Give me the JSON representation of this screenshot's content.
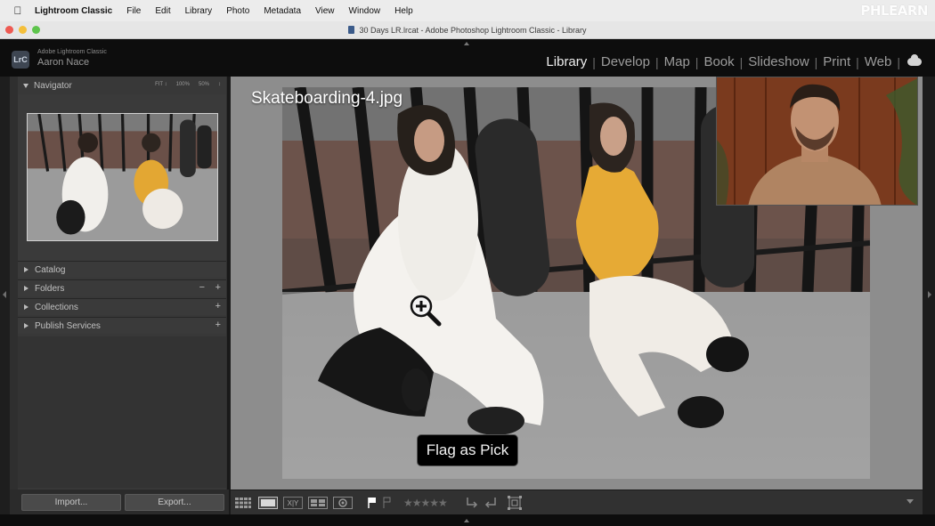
{
  "menubar": {
    "app": "Lightroom Classic",
    "items": [
      "File",
      "Edit",
      "Library",
      "Photo",
      "Metadata",
      "View",
      "Window",
      "Help"
    ],
    "watermark": "PHLEARN"
  },
  "window": {
    "title": "30 Days LR.lrcat - Adobe Photoshop Lightroom Classic - Library"
  },
  "identity": {
    "badge": "LrC",
    "product": "Adobe Lightroom Classic",
    "user": "Aaron Nace"
  },
  "modules": {
    "items": [
      {
        "label": "Library",
        "active": true
      },
      {
        "label": "Develop"
      },
      {
        "label": "Map"
      },
      {
        "label": "Book"
      },
      {
        "label": "Slideshow"
      },
      {
        "label": "Print"
      },
      {
        "label": "Web"
      }
    ],
    "cloud_icon": "cloud-icon"
  },
  "left_panel": {
    "navigator": {
      "title": "Navigator",
      "zoom_options": [
        "FIT ↕",
        "100%",
        "50%",
        "↕"
      ]
    },
    "sections": [
      {
        "label": "Catalog",
        "controls": ""
      },
      {
        "label": "Folders",
        "controls": "+",
        "extra": "−"
      },
      {
        "label": "Collections",
        "controls": "+"
      },
      {
        "label": "Publish Services",
        "controls": "+"
      }
    ],
    "import_label": "Import...",
    "export_label": "Export..."
  },
  "center": {
    "filename": "Skateboarding-4.jpg",
    "toast": "Flag as Pick",
    "cursor_icon": "zoom-in-cursor-icon"
  },
  "toolbar": {
    "views": [
      "grid-view-icon",
      "loupe-view-icon",
      "compare-view-icon",
      "survey-view-icon",
      "people-view-icon"
    ],
    "compare_label": "X|Y",
    "stars": "★★★★★",
    "rating": 0,
    "flag_icons": [
      "pick-flag-icon",
      "reject-flag-icon"
    ],
    "rotate_icons": [
      "rotate-left-icon",
      "rotate-right-icon"
    ],
    "crop_icon": "crop-overlay-icon"
  },
  "colors": {
    "menubar_bg": "#ececec",
    "header_bg": "#0d0d0d",
    "panel_bg": "#383838",
    "center_bg": "#8d8d8d",
    "toast_bg": "#000000",
    "accent_yellow": "#e3a733"
  }
}
